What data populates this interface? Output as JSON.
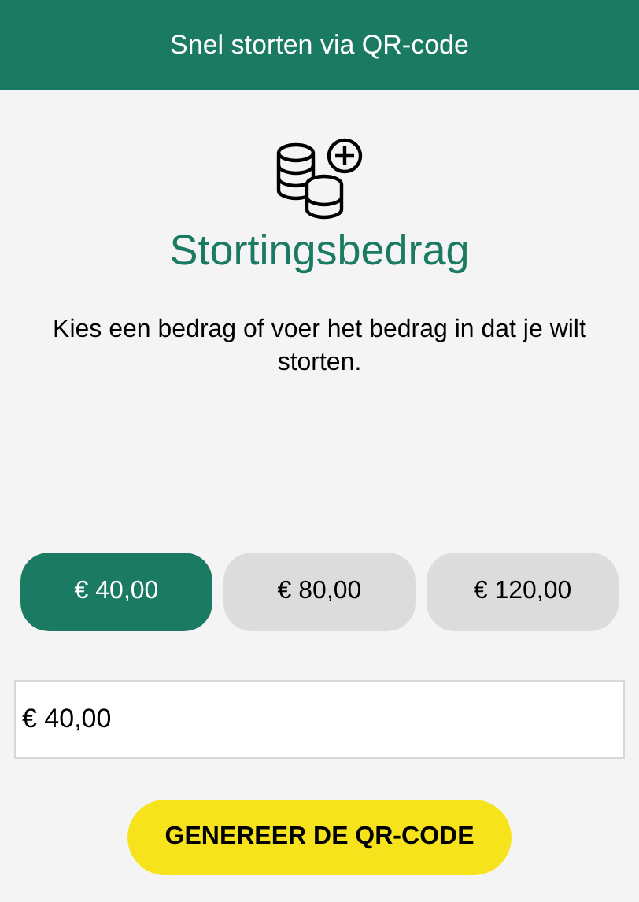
{
  "header": {
    "title": "Snel storten via QR-code"
  },
  "heading": "Stortingsbedrag",
  "instruction": "Kies een bedrag of voer het bedrag in dat je wilt storten.",
  "amounts": [
    {
      "label": "€ 40,00",
      "selected": true
    },
    {
      "label": "€ 80,00",
      "selected": false
    },
    {
      "label": "€ 120,00",
      "selected": false
    }
  ],
  "amount_field": {
    "value": "€ 40,00"
  },
  "button": "GENEREER DE QR-CODE"
}
